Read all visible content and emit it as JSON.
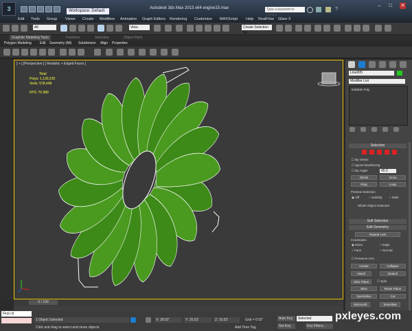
{
  "titlebar": {
    "workspace": "Workspace: Default",
    "title": "Autodesk 3ds Max 2013 x64    engine15.max",
    "search_placeholder": "Type a keyword or phrase",
    "min": "–",
    "max": "□",
    "close": "✕"
  },
  "menubar": [
    "Edit",
    "Tools",
    "Group",
    "Views",
    "Create",
    "Modifiers",
    "Animation",
    "Graph Editors",
    "Rendering",
    "Customize",
    "MAXScript",
    "Help",
    "RealFlow",
    "Glare 3"
  ],
  "toolbar": {
    "filter": "All",
    "view": "View",
    "selection_set": "Create Selection Se"
  },
  "ribbon": {
    "tabs": [
      "Graphite Modeling Tools",
      "Freeform",
      "Selection",
      "Object Paint"
    ],
    "subtabs": [
      "Polygon Modeling",
      "Edit",
      "Geometry (All)",
      "Subdivision",
      "Align",
      "Properties"
    ]
  },
  "viewport": {
    "label": "[ + ] [Perspective ] [ Realistic + Edged Faces ]",
    "stats_header": "Total",
    "polys_label": "Polys:",
    "polys_value": "1,130,220",
    "verts_label": "Verts:",
    "verts_value": "578,448",
    "fps_label": "FPS:",
    "fps_value": "76.989"
  },
  "command_panel": {
    "object_name": "Line005",
    "modifier_list": "Modifier List",
    "stack_item": "Editable Poly",
    "selection_header": "Selection",
    "by_vertex": "By Vertex",
    "ignore_backfacing": "Ignore Backfacing",
    "by_angle": "By Angle:",
    "angle_value": "45.0",
    "shrink": "Shrink",
    "grow": "Grow",
    "ring": "Ring",
    "loop": "Loop",
    "preview_selection": "Preview Selection",
    "preview_off": "Off",
    "preview_subobj": "SubObj",
    "preview_multi": "Multi",
    "selected_text": "Whole Object Selected",
    "soft_selection": "Soft Selection",
    "edit_geometry": "Edit Geometry",
    "repeat_last": "Repeat Last",
    "constraints": "Constraints",
    "c_none": "None",
    "c_edge": "Edge",
    "c_face": "Face",
    "c_normal": "Normal",
    "preserve_uvs": "Preserve UVs",
    "create": "Create",
    "collapse": "Collapse",
    "attach": "Attach",
    "detach": "Detach",
    "slice_plane": "Slice Plane",
    "split": "Split",
    "slice": "Slice",
    "reset_plane": "Reset Plane",
    "quickslice": "QuickSlice",
    "cut": "Cut",
    "msmooth": "MSmooth",
    "tessellate": "Tessellate"
  },
  "timeline": {
    "frame": "0 / 100"
  },
  "status": {
    "maxscript": "First ch",
    "selected": "1 Object Selected",
    "prompt": "Click and drag to select and move objects",
    "x": "X: 28.02'",
    "y": "Y: 25.52'",
    "z": "Z: 10.52'",
    "grid": "Grid = 0'10\"",
    "auto_key": "Auto Key",
    "auto_key_value": "Selected",
    "set_key": "Set Key",
    "key_filters": "Key Filters...",
    "add_time_tag": "Add Time Tag"
  },
  "colors": {
    "title_bg": "#26323f",
    "viewport_border": "#f0c000",
    "blade_green": "#4a9a20",
    "stats_yellow": "#ffff40",
    "object_color": "#22cc22"
  },
  "watermark": "pxleyes.com"
}
